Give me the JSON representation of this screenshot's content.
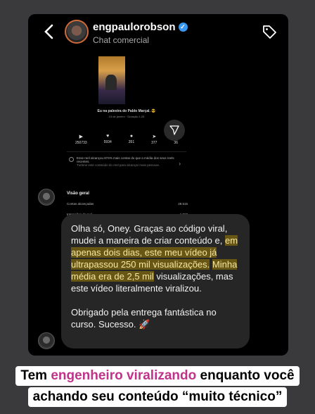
{
  "header": {
    "username": "engpaulorobson",
    "subtitle": "Chat comercial",
    "back_icon": "chevron-left-icon",
    "tag_icon": "tag-icon",
    "verified_icon": "verified-badge-icon"
  },
  "post": {
    "caption": "Eu na palestra do Pablo Marçal. 😎",
    "caption_sub": "15 de janeiro · Duração 1:25",
    "stats": [
      {
        "icon": "play-icon",
        "value": "250733"
      },
      {
        "icon": "heart-icon",
        "value": "5934"
      },
      {
        "icon": "comment-icon",
        "value": "351"
      },
      {
        "icon": "share-icon",
        "value": "377"
      },
      {
        "icon": "bookmark-icon",
        "value": "36"
      }
    ],
    "reach_text": "Esse reel alcançou 874% mais contas do que a média dos seus reels recentes.",
    "reach_sub": "Turbine este conteúdo do reel para alcançar mais pessoas."
  },
  "overview": {
    "title": "Visão geral",
    "rows": [
      {
        "label": "Contas alcançadas",
        "value": "28.515"
      },
      {
        "label": "Interações do reel",
        "value": "1.810"
      }
    ]
  },
  "message": {
    "p1_a": "Olha só, Oney. Graças ao código viral, mudei a maneira de criar conteúdo e, ",
    "p1_hl1": "em apenas dois dias, este meu vídeo já ultrapassou 250 mil visualizações.",
    "p1_hl2": "Minha média era de 2,5 mil",
    "p1_b": " visualizações, mas este vídeo literalmente viralizou.",
    "p2": "Obrigado pela entrega fantástica no curso. Sucesso. 🚀",
    "highlight_color": "#ba9200"
  },
  "banner": {
    "line1_a": "Tem ",
    "line1_pink": "engenheiro viralizando",
    "line1_b": " enquanto você",
    "line2": "achando seu conteúdo “muito técnico”",
    "accent": "#c0338a"
  }
}
